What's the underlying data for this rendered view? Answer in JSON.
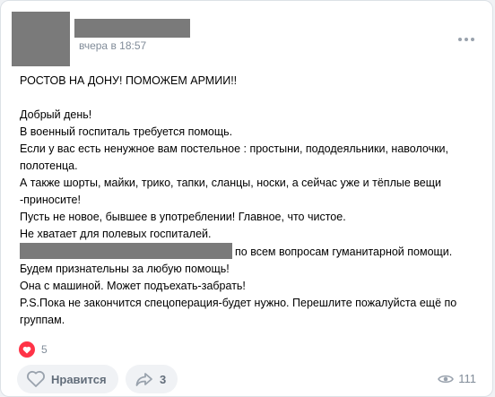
{
  "post": {
    "author_name": "",
    "time": "вчера в 18:57",
    "lines": [
      "РОСТОВ НА ДОНУ! ПОМОЖЕМ АРМИИ!!",
      "",
      "Добрый день!",
      "В военный госпиталь требуется помощь.",
      "Если у вас есть ненужное вам постельное : простыни, пододеяльники, наволочки,",
      "полотенца.",
      "А также шорты, майки, трико, тапки, сланцы, носки, а сейчас уже и тёплые вещи",
      "-приносите!",
      "Пусть не новое, бывшее в употреблении! Главное, что чистое.",
      "Не хватает для полевых госпиталей.",
      "по всем вопросам гуманитарной помощи.",
      "Будем признательны за любую помощь!",
      "Она с машиной. Может подъехать-забрать!",
      "P.S.Пока не закончится спецоперация-будет нужно. Перешлите пожалуйста ещё по",
      "группам."
    ]
  },
  "reactions": {
    "count": "5",
    "icon": "heart-icon",
    "color": "#ff3347"
  },
  "actions": {
    "like_label": "Нравится",
    "share_count": "3",
    "views_count": "111"
  }
}
